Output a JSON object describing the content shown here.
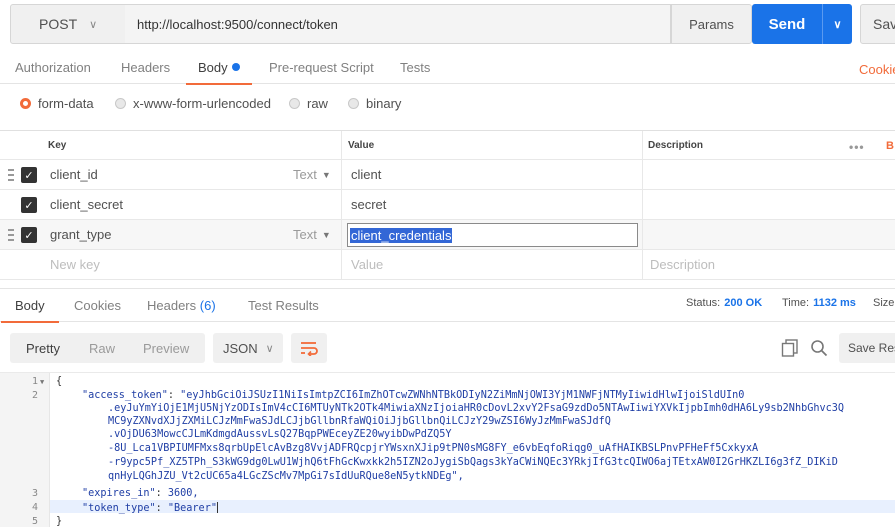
{
  "request": {
    "method": "POST",
    "url": "http://localhost:9500/connect/token",
    "params_label": "Params",
    "send_label": "Send",
    "save_label": "Sav"
  },
  "request_tabs": [
    {
      "label": "Authorization"
    },
    {
      "label": "Headers"
    },
    {
      "label": "Body"
    },
    {
      "label": "Pre-request Script"
    },
    {
      "label": "Tests"
    }
  ],
  "cookies_link": "Cookie",
  "body_types": [
    {
      "label": "form-data",
      "selected": true
    },
    {
      "label": "x-www-form-urlencoded",
      "selected": false
    },
    {
      "label": "raw",
      "selected": false
    },
    {
      "label": "binary",
      "selected": false
    }
  ],
  "params_table": {
    "headers": {
      "key": "Key",
      "value": "Value",
      "description": "Description",
      "more": "•••",
      "bulk": "B"
    },
    "rows": [
      {
        "key": "client_id",
        "type": "Text",
        "value": "client"
      },
      {
        "key": "client_secret",
        "type": "",
        "value": "secret"
      },
      {
        "key": "grant_type",
        "type": "Text",
        "value": "client_credentials"
      }
    ],
    "new_row": {
      "key_placeholder": "New key",
      "value_placeholder": "Value",
      "description_placeholder": "Description"
    }
  },
  "response_tabs": [
    {
      "label": "Body"
    },
    {
      "label": "Cookies"
    },
    {
      "label": "Headers",
      "count": "(6)"
    },
    {
      "label": "Test Results"
    }
  ],
  "response_status": {
    "status_label": "Status:",
    "status_value": "200 OK",
    "time_label": "Time:",
    "time_value": "1132 ms",
    "size_label": "Size"
  },
  "response_toolbar": {
    "formats": [
      "Pretty",
      "Raw",
      "Preview"
    ],
    "active_format": "Pretty",
    "language": "JSON",
    "save_response": "Save Res"
  },
  "response_body": {
    "line_numbers": [
      "1",
      "2",
      "3",
      "4",
      "5"
    ],
    "open_brace": "{",
    "close_brace": "}",
    "access_token_key": "\"access_token\"",
    "access_token_lines": [
      "\"eyJhbGciOiJSUzI1NiIsImtpZCI6ImZhOTcwZWNhNTBkODIyN2ZiMmNjOWI3YjM1NWFjNTMyIiwidHlwIjoiSldUIn0",
      ".eyJuYmYiOjE1MjU5NjYzODIsImV4cCI6MTUyNTk2OTk4MiwiaXNzIjoiaHR0cDovL2xvY2FsaG9zdDo5NTAwIiwiYXVkIjpbImh0dHA6Ly9sb2NhbGhvc3Q",
      "MC9yZXNvdXJjZXMiLCJzMmFwaSJdLCJjbGllbnRfaWQiOiJjbGllbnQiLCJzY29wZSI6WyJzMmFwaSJdfQ",
      ".vOjDU63MowcCJLmKdmgdAussvLsQ27BqpPWEceyZE20wyibDwPdZQ5Y",
      "-8U_Lca1VBPIUMFMxs8qrbUpElcAvBzg8VvjADFRQcpjrYWsxnXJip9tPN0sMG8FY_e6vbEqfoRiqg0_uAfHAIKBSLPnvPFHeFf5CxkyxA",
      "-r9ypc5Pf_XZ5TPh_S3kWG9dg0LwU1WjhQ6tFhGcKwxkk2h5IZN2oJygiSbQags3kYaCWiNQEc3YRkjIfG3tcQIWO6ajTEtxAW0I2GrHKZLI6g3fZ_DIKiD",
      "qnHyLQGhJZU_Vt2cUC65a4LGcZScMv7MpGi7sIdUuRQue8eN5ytkNDEg\","
    ],
    "expires_in_key": "\"expires_in\"",
    "expires_in_value": "3600,",
    "token_type_key": "\"token_type\"",
    "token_type_value": "\"Bearer\""
  }
}
